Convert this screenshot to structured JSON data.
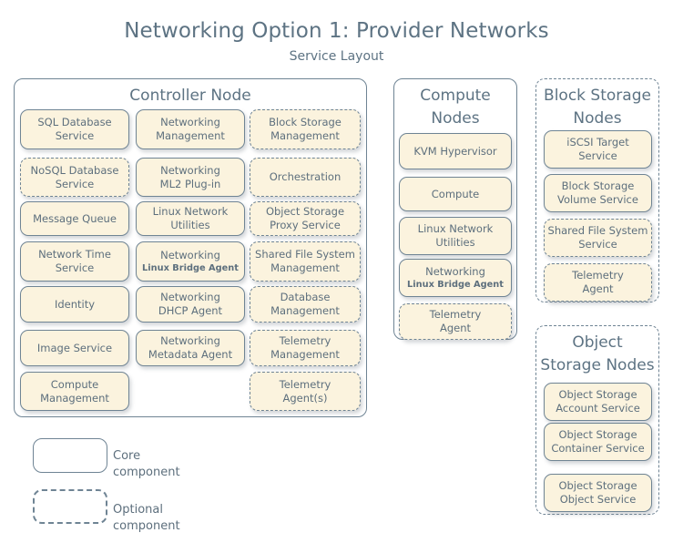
{
  "title": {
    "main": "Networking Option 1: Provider Networks",
    "sub": "Service Layout"
  },
  "colors": {
    "service_fill": "#fbf3de",
    "border": "#6f8494",
    "text": "#5d6f7d",
    "title_text": "#5d7383",
    "background": "#ffffff"
  },
  "nodes": [
    {
      "id": "controller-node",
      "title": "Controller Node",
      "type": "core",
      "columns": [
        [
          {
            "label": "SQL Database Service",
            "lines": [
              "SQL Database",
              "Service"
            ],
            "type": "core"
          },
          {
            "label": "NoSQL Database Service",
            "lines": [
              "NoSQL Database",
              "Service"
            ],
            "type": "optional"
          },
          {
            "label": "Message Queue",
            "lines": [
              "Message Queue"
            ],
            "type": "core"
          },
          {
            "label": "Network Time Service",
            "lines": [
              "Network Time",
              "Service"
            ],
            "type": "core"
          },
          {
            "label": "Identity",
            "lines": [
              "Identity"
            ],
            "type": "core"
          },
          {
            "label": "Image Service",
            "lines": [
              "Image Service"
            ],
            "type": "core"
          },
          {
            "label": "Compute Management",
            "lines": [
              "Compute",
              "Management"
            ],
            "type": "core"
          }
        ],
        [
          {
            "label": "Networking Management",
            "lines": [
              "Networking",
              "Management"
            ],
            "type": "core"
          },
          {
            "label": "Networking ML2 Plug-in",
            "lines": [
              "Networking",
              "ML2 Plug-in"
            ],
            "type": "core"
          },
          {
            "label": "Linux Network Utilities",
            "lines": [
              "Linux Network",
              "Utilities"
            ],
            "type": "core"
          },
          {
            "label": "Networking Linux Bridge Agent",
            "lines": [
              "Networking",
              "Linux Bridge Agent"
            ],
            "type": "core",
            "sublabel": true
          },
          {
            "label": "Networking DHCP Agent",
            "lines": [
              "Networking",
              "DHCP Agent"
            ],
            "type": "core"
          },
          {
            "label": "Networking Metadata Agent",
            "lines": [
              "Networking",
              "Metadata Agent"
            ],
            "type": "core"
          }
        ],
        [
          {
            "label": "Block Storage Management",
            "lines": [
              "Block Storage",
              "Management"
            ],
            "type": "optional"
          },
          {
            "label": "Orchestration",
            "lines": [
              "Orchestration"
            ],
            "type": "optional"
          },
          {
            "label": "Object Storage Proxy Service",
            "lines": [
              "Object Storage",
              "Proxy Service"
            ],
            "type": "optional"
          },
          {
            "label": "Shared File System Management",
            "lines": [
              "Shared File System",
              "Management"
            ],
            "type": "optional"
          },
          {
            "label": "Database Management",
            "lines": [
              "Database",
              "Management"
            ],
            "type": "optional"
          },
          {
            "label": "Telemetry Management",
            "lines": [
              "Telemetry",
              "Management"
            ],
            "type": "optional"
          },
          {
            "label": "Telemetry Agent(s)",
            "lines": [
              "Telemetry",
              "Agent(s)"
            ],
            "type": "optional"
          }
        ]
      ]
    },
    {
      "id": "compute-nodes",
      "title": "Compute Nodes",
      "title_lines": [
        "Compute",
        "Nodes"
      ],
      "type": "core",
      "services": [
        {
          "label": "KVM Hypervisor",
          "lines": [
            "KVM Hypervisor"
          ],
          "type": "core"
        },
        {
          "label": "Compute",
          "lines": [
            "Compute"
          ],
          "type": "core"
        },
        {
          "label": "Linux Network Utilities",
          "lines": [
            "Linux Network",
            "Utilities"
          ],
          "type": "core"
        },
        {
          "label": "Networking Linux Bridge Agent",
          "lines": [
            "Networking",
            "Linux Bridge Agent"
          ],
          "type": "core",
          "sublabel": true
        },
        {
          "label": "Telemetry Agent",
          "lines": [
            "Telemetry",
            "Agent"
          ],
          "type": "optional"
        }
      ]
    },
    {
      "id": "block-storage-nodes",
      "title": "Block Storage Nodes",
      "title_lines": [
        "Block Storage",
        "Nodes"
      ],
      "type": "optional",
      "services": [
        {
          "label": "iSCSI Target Service",
          "lines": [
            "iSCSI Target",
            "Service"
          ],
          "type": "core"
        },
        {
          "label": "Block Storage Volume Service",
          "lines": [
            "Block Storage",
            "Volume Service"
          ],
          "type": "core"
        },
        {
          "label": "Shared File System Service",
          "lines": [
            "Shared File System",
            "Service"
          ],
          "type": "optional"
        },
        {
          "label": "Telemetry Agent",
          "lines": [
            "Telemetry",
            "Agent"
          ],
          "type": "optional"
        }
      ]
    },
    {
      "id": "object-storage-nodes",
      "title": "Object Storage Nodes",
      "title_lines": [
        "Object",
        "Storage Nodes"
      ],
      "type": "optional",
      "services": [
        {
          "label": "Object Storage Account Service",
          "lines": [
            "Object Storage",
            "Account Service"
          ],
          "type": "core"
        },
        {
          "label": "Object Storage Container Service",
          "lines": [
            "Object Storage",
            "Container Service"
          ],
          "type": "core"
        },
        {
          "label": "Object Storage Object Service",
          "lines": [
            "Object Storage",
            "Object Service"
          ],
          "type": "core"
        }
      ]
    }
  ],
  "legend": [
    {
      "type": "core",
      "label": "Core component"
    },
    {
      "type": "optional",
      "label": "Optional component"
    }
  ]
}
